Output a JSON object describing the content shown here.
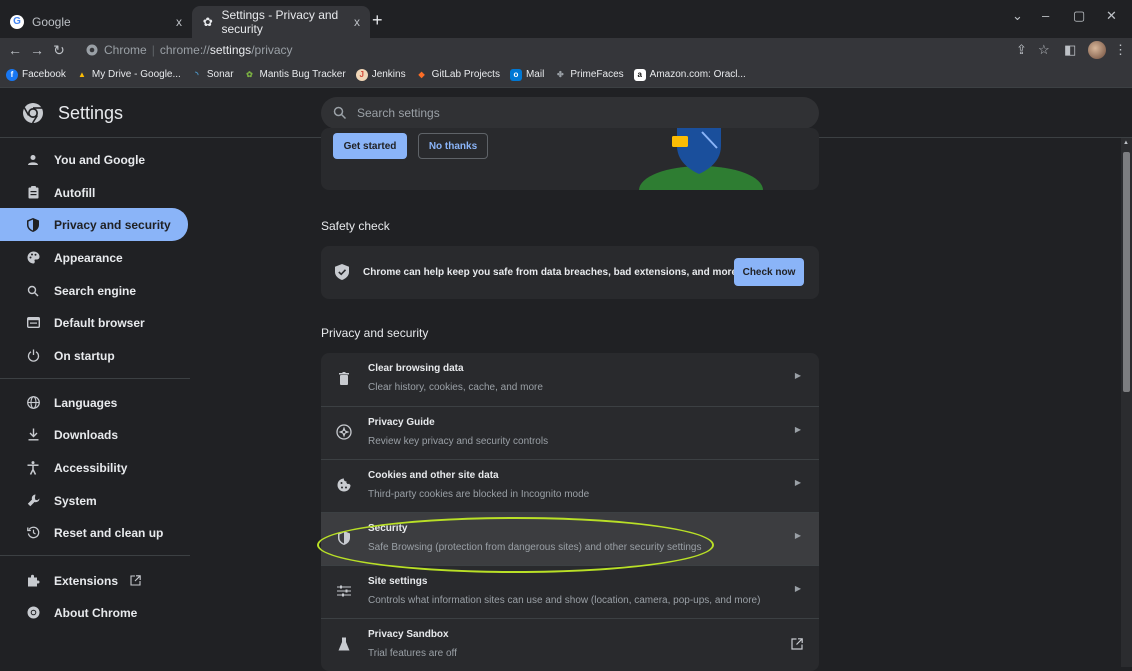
{
  "tabs": [
    {
      "title": "Google",
      "close": "x"
    },
    {
      "title": "Settings - Privacy and security",
      "close": "x"
    }
  ],
  "new_tab": "+",
  "window_controls": {
    "chevron": "⌄",
    "minimize": "–",
    "restore": "▢",
    "close": "✕"
  },
  "omnibox": {
    "site": "Chrome",
    "url_prefix": "chrome://",
    "url_strong": "settings",
    "url_rest": "/privacy"
  },
  "bookmarks": [
    {
      "label": "Facebook",
      "icon": "facebook-icon",
      "color": "#1877f2",
      "glyph": "f"
    },
    {
      "label": "My Drive - Google...",
      "icon": "google-drive-icon",
      "color": "#34a853",
      "glyph": "▲"
    },
    {
      "label": "Sonar",
      "icon": "sonar-icon",
      "color": "#4e9bcd",
      "glyph": "◝"
    },
    {
      "label": "Mantis Bug Tracker",
      "icon": "mantis-icon",
      "color": "#7cb342",
      "glyph": "✿"
    },
    {
      "label": "Jenkins",
      "icon": "jenkins-icon",
      "color": "#d24939",
      "glyph": "J"
    },
    {
      "label": "GitLab Projects",
      "icon": "gitlab-icon",
      "color": "#fc6d26",
      "glyph": "◆"
    },
    {
      "label": "Mail",
      "icon": "mail-icon",
      "color": "#0078d4",
      "glyph": "o"
    },
    {
      "label": "PrimeFaces",
      "icon": "primefaces-icon",
      "color": "#9aa0a6",
      "glyph": "✤"
    },
    {
      "label": "Amazon.com: Oracl...",
      "icon": "amazon-icon",
      "color": "#ffffff",
      "glyph": "a"
    }
  ],
  "header": {
    "title": "Settings",
    "search_placeholder": "Search settings"
  },
  "sidebar": {
    "items": [
      {
        "label": "You and Google",
        "icon": "person-icon"
      },
      {
        "label": "Autofill",
        "icon": "clipboard-icon"
      },
      {
        "label": "Privacy and security",
        "icon": "shield-icon",
        "active": true
      },
      {
        "label": "Appearance",
        "icon": "palette-icon"
      },
      {
        "label": "Search engine",
        "icon": "search-icon"
      },
      {
        "label": "Default browser",
        "icon": "browser-icon"
      },
      {
        "label": "On startup",
        "icon": "power-icon"
      },
      {
        "label": "Languages",
        "icon": "globe-icon"
      },
      {
        "label": "Downloads",
        "icon": "download-icon"
      },
      {
        "label": "Accessibility",
        "icon": "accessibility-icon"
      },
      {
        "label": "System",
        "icon": "wrench-icon"
      },
      {
        "label": "Reset and clean up",
        "icon": "restore-icon"
      },
      {
        "label": "Extensions",
        "icon": "puzzle-icon"
      },
      {
        "label": "About Chrome",
        "icon": "chrome-icon"
      }
    ]
  },
  "promo": {
    "get_started": "Get started",
    "no_thanks": "No thanks"
  },
  "safety_check": {
    "title": "Safety check",
    "text": "Chrome can help keep you safe from data breaches, bad extensions, and more",
    "button": "Check now"
  },
  "privacy": {
    "title": "Privacy and security",
    "rows": [
      {
        "title": "Clear browsing data",
        "subtitle": "Clear history, cookies, cache, and more",
        "icon": "trash-icon"
      },
      {
        "title": "Privacy Guide",
        "subtitle": "Review key privacy and security controls",
        "icon": "compass-icon"
      },
      {
        "title": "Cookies and other site data",
        "subtitle": "Third-party cookies are blocked in Incognito mode",
        "icon": "cookie-icon"
      },
      {
        "title": "Security",
        "subtitle": "Safe Browsing (protection from dangerous sites) and other security settings",
        "icon": "shield-icon"
      },
      {
        "title": "Site settings",
        "subtitle": "Controls what information sites can use and show (location, camera, pop-ups, and more)",
        "icon": "sliders-icon"
      },
      {
        "title": "Privacy Sandbox",
        "subtitle": "Trial features are off",
        "icon": "flask-icon"
      }
    ]
  },
  "colors": {
    "accent": "#8ab4f8",
    "highlight_ellipse": "#b9e026",
    "background": "#202124",
    "card": "#292a2d"
  }
}
